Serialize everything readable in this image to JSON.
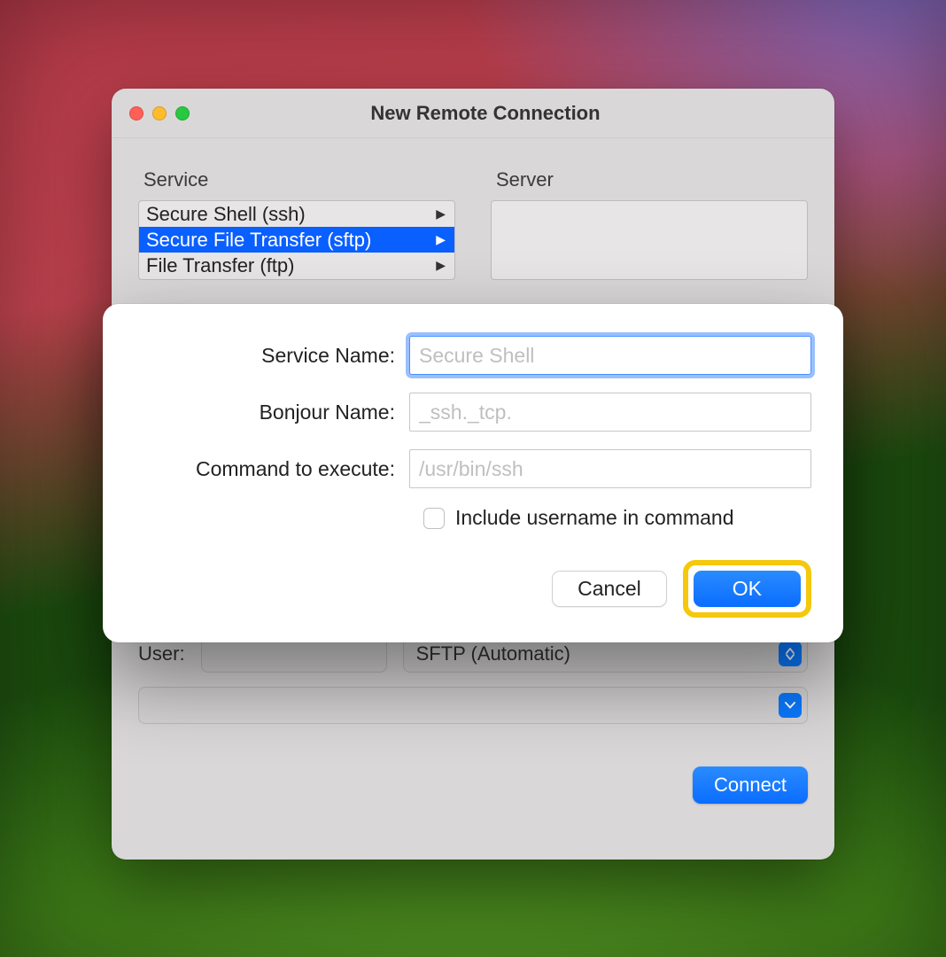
{
  "window": {
    "title": "New Remote Connection",
    "service_header": "Service",
    "server_header": "Server",
    "services": [
      {
        "label": "Secure Shell (ssh)",
        "selected": false
      },
      {
        "label": "Secure File Transfer (sftp)",
        "selected": true
      },
      {
        "label": "File Transfer (ftp)",
        "selected": false
      }
    ],
    "user_label": "User:",
    "user_value": "",
    "scheme_selected": "SFTP (Automatic)",
    "connect_label": "Connect"
  },
  "sheet": {
    "service_name_label": "Service Name:",
    "service_name_placeholder": "Secure Shell",
    "bonjour_label": "Bonjour Name:",
    "bonjour_placeholder": "_ssh._tcp.",
    "command_label": "Command to execute:",
    "command_placeholder": "/usr/bin/ssh",
    "include_username_label": "Include username in command",
    "cancel_label": "Cancel",
    "ok_label": "OK"
  }
}
